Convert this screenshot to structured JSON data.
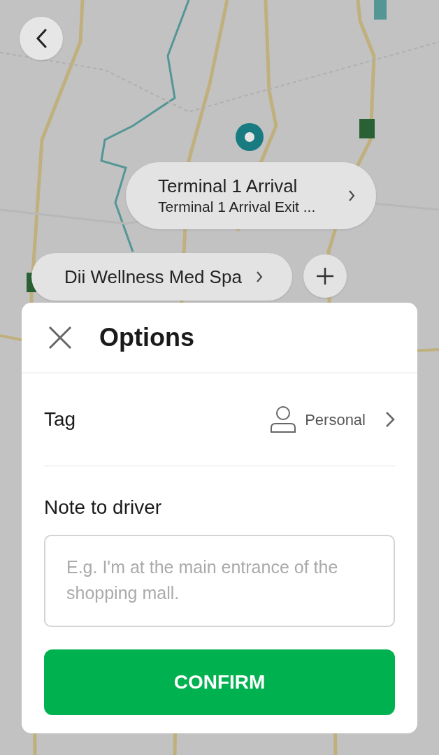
{
  "destination_pill": {
    "title": "Terminal 1 Arrival",
    "subtitle": "Terminal 1 Arrival Exit ..."
  },
  "stop_pill": {
    "title": "Dii Wellness Med Spa"
  },
  "options_sheet": {
    "title": "Options",
    "tag_row": {
      "label": "Tag",
      "value": "Personal"
    },
    "note": {
      "label": "Note to driver",
      "placeholder": "E.g. I'm at the main entrance of the shopping mall."
    },
    "confirm_button": "CONFIRM"
  }
}
